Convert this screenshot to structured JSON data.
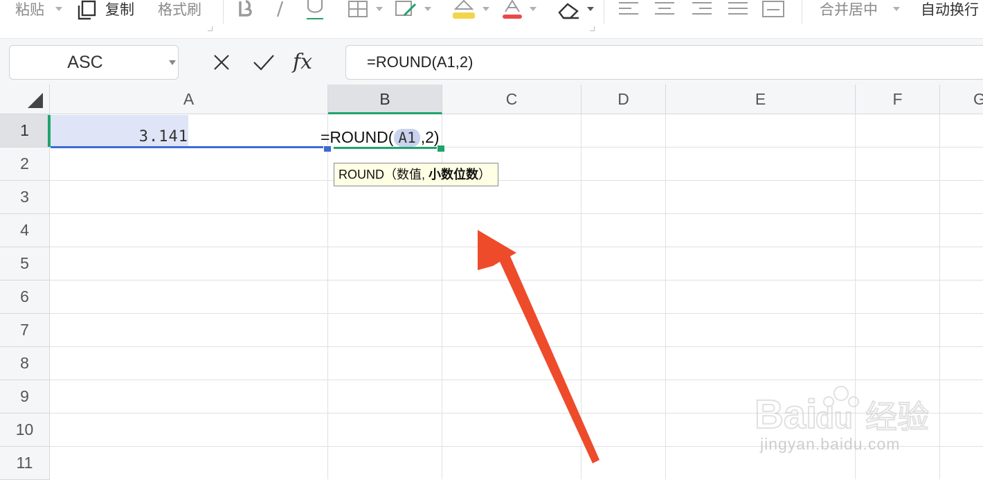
{
  "toolbar": {
    "paste_label": "粘贴",
    "copy_label": "复制",
    "format_painter_label": "格式刷",
    "merge_center_label": "合并居中",
    "wrap_text_label": "自动换行",
    "icons": [
      "bold-icon",
      "italic-icon",
      "underline-icon",
      "border-icon",
      "fill-color-icon",
      "highlight-icon",
      "font-color-icon",
      "eraser-icon",
      "align-left-icon",
      "align-center-icon",
      "align-right-icon",
      "justify-icon",
      "align-bottom-icon"
    ],
    "colors": {
      "fill_accent": "#f3d54a",
      "font_color_accent": "#e84a4a"
    }
  },
  "formula_bar": {
    "name_box": "ASC",
    "cancel_icon": "close-icon",
    "enter_icon": "check-icon",
    "fx_label": "fx",
    "formula": "=ROUND(A1,2)"
  },
  "grid": {
    "columns": [
      "A",
      "B",
      "C",
      "D",
      "E",
      "F",
      "G"
    ],
    "rows": [
      "1",
      "2",
      "3",
      "4",
      "5",
      "6",
      "7",
      "8",
      "9",
      "10",
      "11"
    ],
    "selected_column": "B",
    "selected_row": "1",
    "cell_a1": "3.141",
    "cell_b1": {
      "prefix": "=ROUND(",
      "ref": "A1",
      "suffix": ",2)"
    },
    "tooltip": {
      "func": "ROUND",
      "open": "（数值, ",
      "active_arg": "小数位数",
      "close": "）"
    },
    "colors": {
      "selected_header_accent": "#1fa36b",
      "ref_highlight": "#3d6bd4"
    }
  },
  "annotation": {
    "arrow_color": "#ee4b2b"
  },
  "watermark": {
    "site": "jingyan.baidu.com"
  }
}
